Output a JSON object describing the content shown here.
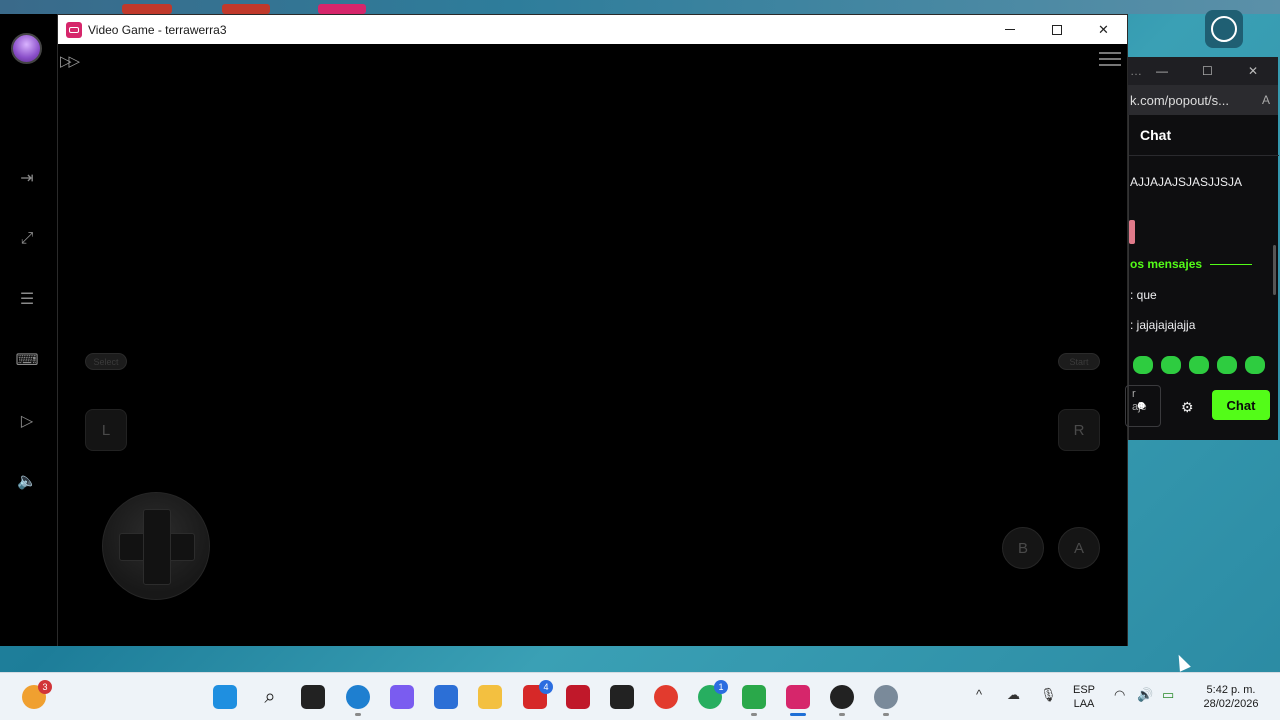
{
  "game_window": {
    "title": "Video Game - terrawerra3",
    "controls": {
      "select_label": "Select",
      "start_label": "Start",
      "l_label": "L",
      "r_label": "R",
      "b_label": "B",
      "a_label": "A"
    }
  },
  "chat_window": {
    "url": "k.com/popout/s...",
    "header": "Chat",
    "messages": [
      {
        "text": "AJJAJAJSJASJJSJA"
      },
      {
        "text": ": que"
      },
      {
        "text": ": jajajajajajja"
      }
    ],
    "new_messages_label": "os mensajes",
    "input_placeholder": "r\naje",
    "send_label": "Chat"
  },
  "taskbar": {
    "notification_badge": "3",
    "lens_badge": "4",
    "whatsapp_badge": "1",
    "language_top": "ESP",
    "language_bottom": "LAA",
    "time": "5:42 p. m.",
    "date": "28/02/2026"
  },
  "colors": {
    "accent_green": "#53fc18",
    "title_icon": "#d6266b",
    "taskbar_bg": "#eef3f8"
  }
}
